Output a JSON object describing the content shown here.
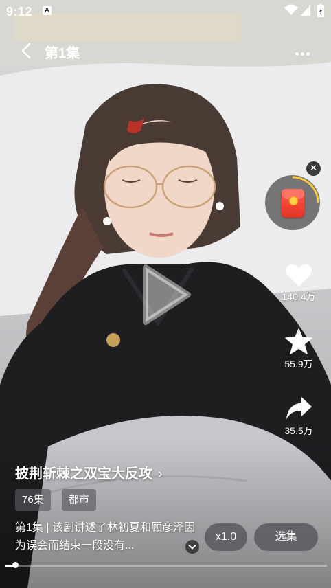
{
  "status_bar": {
    "time": "9:12",
    "notification_icon": "A"
  },
  "header": {
    "episode_title": "第1集"
  },
  "side_actions": {
    "like_count": "140.4万",
    "favorite_count": "55.9万",
    "share_count": "35.5万"
  },
  "drama": {
    "title": "披荆斩棘之双宝大反攻",
    "title_chevron": "›",
    "tags": [
      "76集",
      "都市"
    ],
    "description": "第1集 | 该剧讲述了林初夏和顾彦泽因为误会而结束一段没有..."
  },
  "controls": {
    "speed_label": "x1.0",
    "episodes_label": "选集",
    "progress": 0.03
  },
  "colors": {
    "accent": "#f6c93d",
    "envelope": "#e53326"
  }
}
